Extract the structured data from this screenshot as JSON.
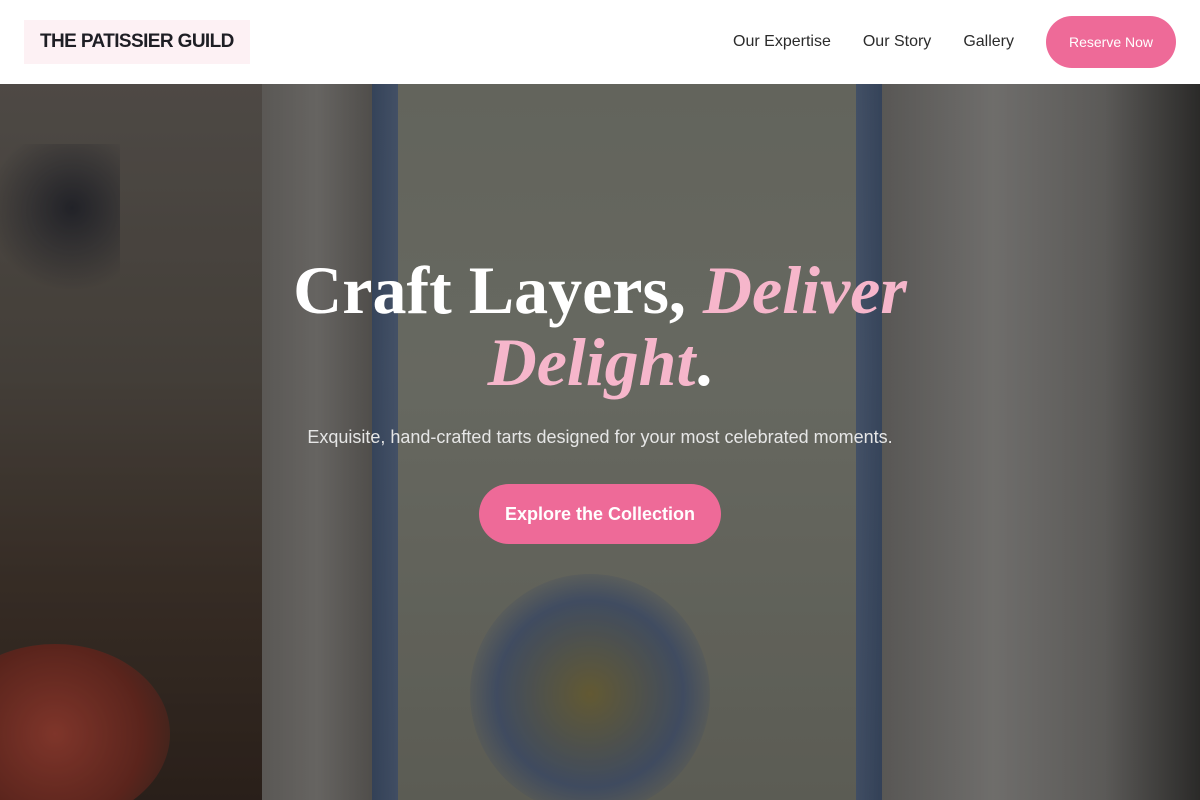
{
  "header": {
    "logo_text": "THE PATISSIER GUILD",
    "nav": [
      {
        "label": "Our Expertise"
      },
      {
        "label": "Our Story"
      },
      {
        "label": "Gallery"
      }
    ],
    "reserve_label": "Reserve Now"
  },
  "hero": {
    "headline_plain": "Craft Layers, ",
    "headline_accent_line1": "Deliver",
    "headline_accent_line2": "Delight",
    "headline_end": ".",
    "subtitle": "Exquisite, hand-crafted tarts designed for your most celebrated moments.",
    "cta_label": "Explore the Collection"
  },
  "colors": {
    "accent": "#ee6a98",
    "accent_text": "#f6b6cb",
    "header_bg": "#ffffff",
    "logo_bg": "#fdf1f4"
  }
}
